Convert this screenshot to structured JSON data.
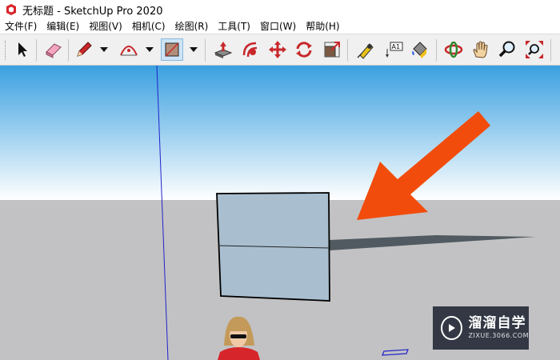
{
  "window": {
    "title": "无标题 - SketchUp Pro 2020",
    "app_icon": "sketchup-logo-icon"
  },
  "menu": [
    "文件(F)",
    "编辑(E)",
    "视图(V)",
    "相机(C)",
    "绘图(R)",
    "工具(T)",
    "窗口(W)",
    "帮助(H)"
  ],
  "toolbar": {
    "tools": [
      {
        "name": "select-tool",
        "icon": "arrow-cursor-icon"
      },
      {
        "name": "eraser-tool",
        "icon": "eraser-icon"
      },
      {
        "name": "line-tool",
        "icon": "pencil-icon"
      },
      {
        "name": "arc-tool",
        "icon": "arc-icon"
      },
      {
        "name": "rectangle-tool",
        "icon": "rectangle-icon",
        "selected": true
      },
      {
        "name": "push-pull-tool",
        "icon": "push-pull-icon"
      },
      {
        "name": "follow-me-tool",
        "icon": "follow-me-icon"
      },
      {
        "name": "move-tool",
        "icon": "move-arrows-icon"
      },
      {
        "name": "rotate-tool",
        "icon": "rotate-icon"
      },
      {
        "name": "scale-tool",
        "icon": "scale-icon"
      },
      {
        "name": "tape-measure-tool",
        "icon": "tape-measure-icon"
      },
      {
        "name": "text-tool",
        "icon": "text-label-icon",
        "label": "A1"
      },
      {
        "name": "paint-bucket-tool",
        "icon": "paint-bucket-icon"
      },
      {
        "name": "orbit-tool",
        "icon": "orbit-icon"
      },
      {
        "name": "pan-tool",
        "icon": "hand-icon"
      },
      {
        "name": "zoom-tool",
        "icon": "magnifier-icon"
      },
      {
        "name": "zoom-extents-tool",
        "icon": "zoom-extents-icon"
      }
    ]
  },
  "viewport": {
    "sky_top_color": "#3aa0e0",
    "sky_bottom_color": "#ffffff",
    "ground_color": "#c2c2c4",
    "face_color": "#a9bfd0",
    "arrow_color": "#f24c0c"
  },
  "watermark": {
    "brand": "溜溜自学",
    "url": "ZIXUE.3066.COM"
  }
}
